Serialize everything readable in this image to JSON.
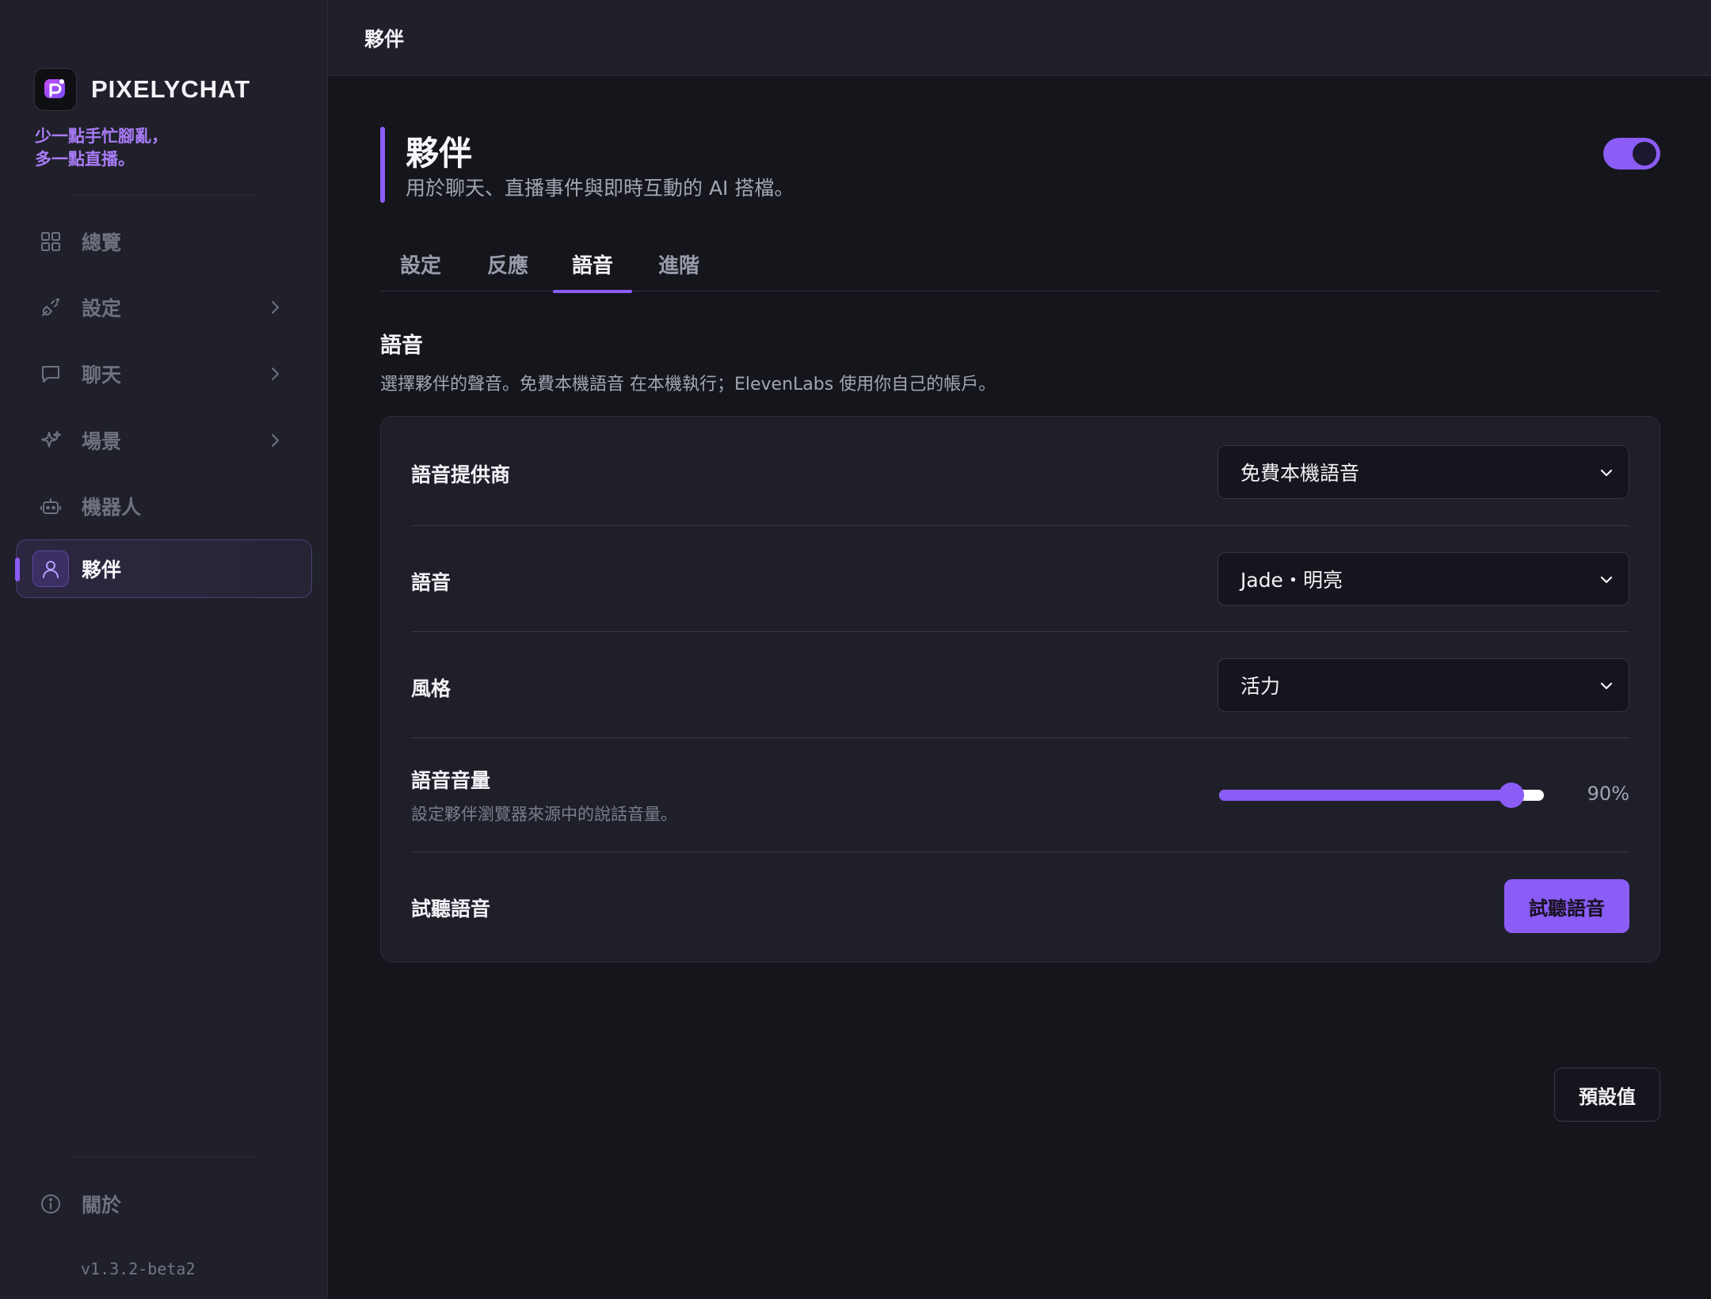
{
  "app": {
    "brand": "PIXELYCHAT",
    "tagline": [
      "少一點手忙腳亂，",
      "多一點直播。"
    ],
    "version": "v1.3.2-beta2",
    "accent": "#8b5cf6"
  },
  "sidebar": {
    "items": [
      {
        "label": "總覽",
        "icon": "grid-icon"
      },
      {
        "label": "設定",
        "icon": "plug-icon"
      },
      {
        "label": "聊天",
        "icon": "chat-icon"
      },
      {
        "label": "場景",
        "icon": "sparkle-icon"
      },
      {
        "label": "機器人",
        "icon": "robot-icon"
      },
      {
        "label": "夥伴",
        "icon": "user-icon",
        "active": true
      }
    ],
    "footer": {
      "label": "關於",
      "icon": "info-icon"
    }
  },
  "topbar": {
    "title": "夥伴"
  },
  "page": {
    "title": "夥伴",
    "subtitle": "用於聊天、直播事件與即時互動的 AI 搭檔。",
    "enabled": true
  },
  "tabs": [
    {
      "label": "設定"
    },
    {
      "label": "反應"
    },
    {
      "label": "語音",
      "active": true
    },
    {
      "label": "進階"
    }
  ],
  "voice": {
    "section_title": "語音",
    "section_desc": "選擇夥伴的聲音。免費本機語音 在本機執行；ElevenLabs 使用你自己的帳戶。",
    "provider": {
      "label": "語音提供商",
      "value": "免費本機語音"
    },
    "voice": {
      "label": "語音",
      "value": "Jade・明亮"
    },
    "style": {
      "label": "風格",
      "value": "活力"
    },
    "volume": {
      "label": "語音音量",
      "hint": "設定夥伴瀏覽器來源中的說話音量。",
      "value": 90,
      "display": "90%"
    },
    "preview": {
      "label": "試聽語音",
      "button": "試聽語音"
    },
    "defaults_button": "預設值"
  }
}
